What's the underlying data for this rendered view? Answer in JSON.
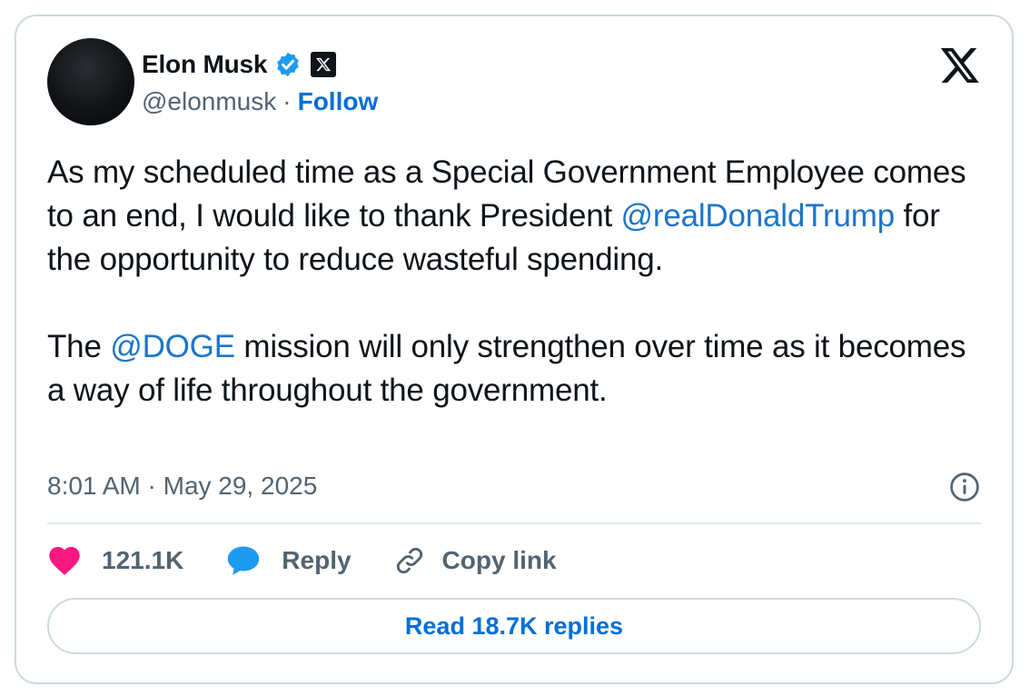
{
  "author": {
    "name": "Elon Musk",
    "handle": "@elonmusk",
    "follow_label": "Follow",
    "verified_icon": "verified-badge-icon",
    "affiliation_icon": "x-affiliation-icon"
  },
  "brand": {
    "logo_icon": "x-logo-icon"
  },
  "tweet": {
    "paragraph1": {
      "before": "As my scheduled time as a Special Government Employee comes to an end, I would like to thank President ",
      "mention": "@realDonaldTrump",
      "after": " for the opportunity to reduce wasteful spending."
    },
    "paragraph2": {
      "before": "The ",
      "mention": "@DOGE",
      "after": " mission will only strengthen over time as it becomes a way of life throughout the government."
    },
    "timestamp": "8:01 AM · May 29, 2025"
  },
  "actions": {
    "likes": "121.1K",
    "reply_label": "Reply",
    "copy_link_label": "Copy link"
  },
  "read_replies_label": "Read 18.7K replies",
  "colors": {
    "accent": "#006fd6",
    "mention": "#1d74c9",
    "heart": "#f91880",
    "reply_bubble": "#1d9bf0",
    "secondary_text": "#536471",
    "border": "#cfd9de"
  }
}
